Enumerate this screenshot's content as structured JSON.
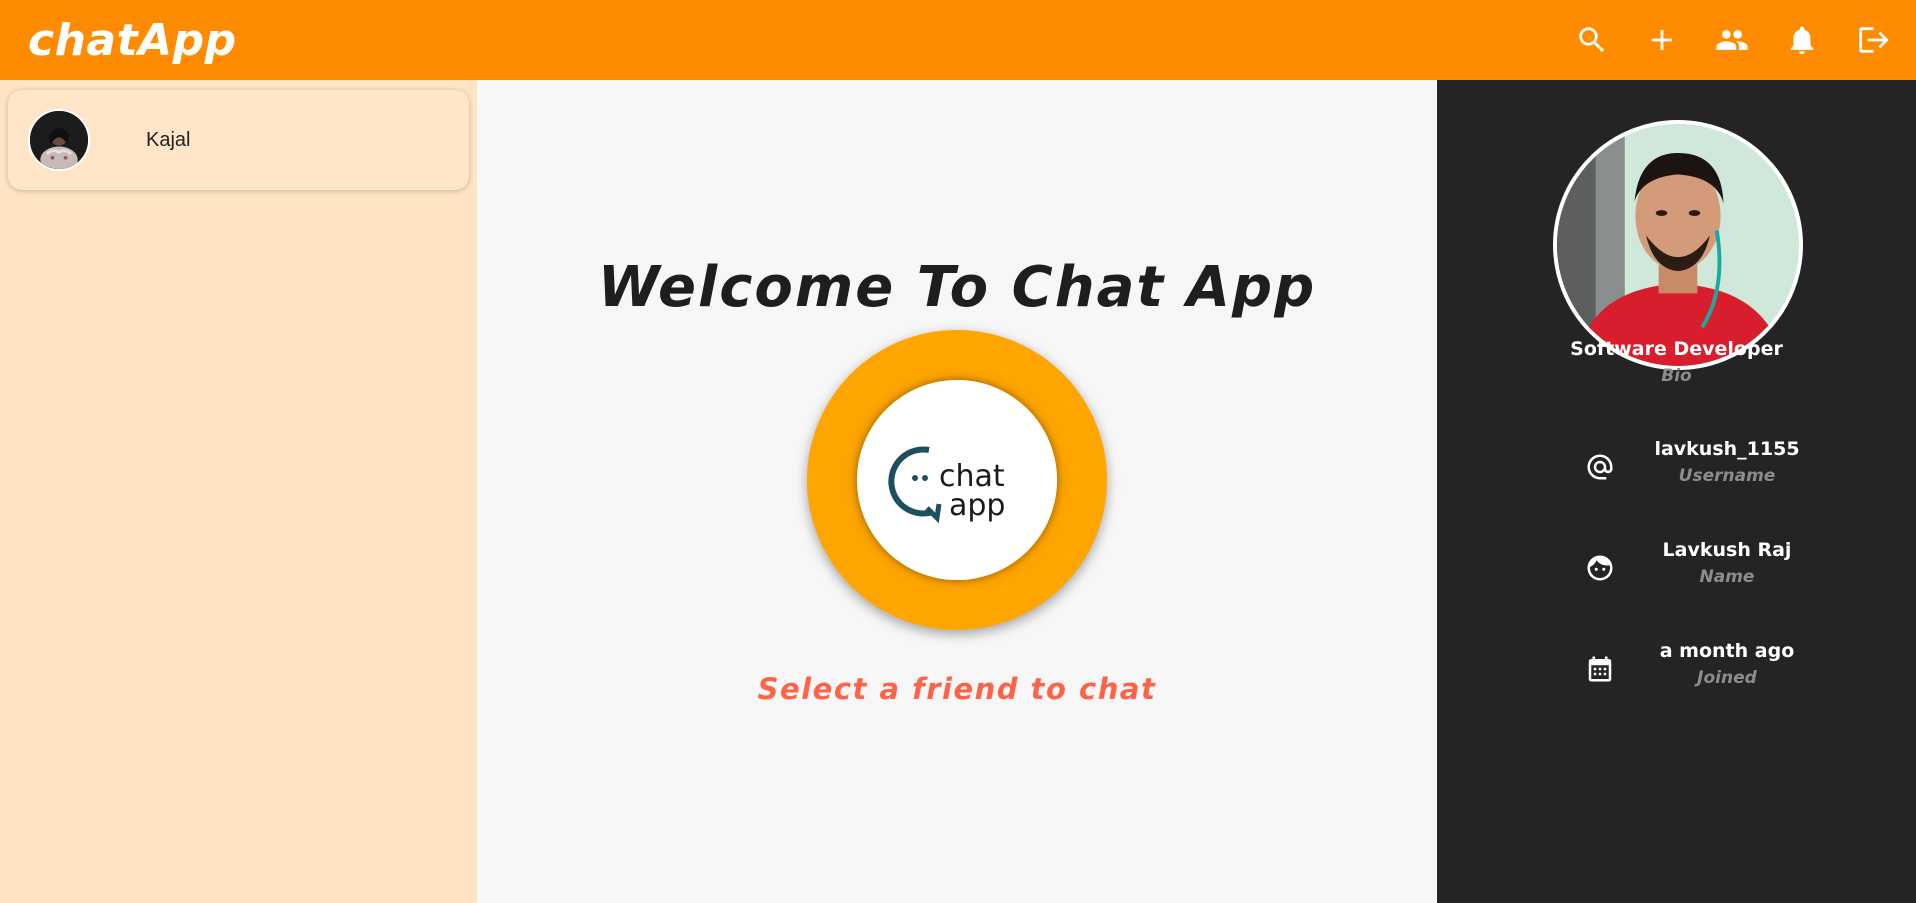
{
  "header": {
    "brand": "chatApp",
    "actions": [
      {
        "icon": "search-icon"
      },
      {
        "icon": "plus-icon"
      },
      {
        "icon": "people-icon"
      },
      {
        "icon": "bell-icon"
      },
      {
        "icon": "logout-icon"
      }
    ]
  },
  "sidebar": {
    "contacts": [
      {
        "name": "Kajal"
      }
    ]
  },
  "main": {
    "welcome": "Welcome To Chat App",
    "prompt": "Select a friend to chat",
    "logo_text_top": "chat",
    "logo_text_bottom": "app"
  },
  "profile": {
    "bio": {
      "value": "Software Developer",
      "label": "Bio"
    },
    "username": {
      "value": "lavkush_1155",
      "label": "Username",
      "icon": "at-icon"
    },
    "name": {
      "value": "Lavkush Raj",
      "label": "Name",
      "icon": "face-icon"
    },
    "joined": {
      "value": "a month ago",
      "label": "Joined",
      "icon": "calendar-icon"
    }
  },
  "colors": {
    "topbar": "#ff8c00",
    "sidebar": "#ffe4c4",
    "profile_panel": "#242424",
    "logo_ring": "#ffa500",
    "prompt_text": "#ff6347"
  }
}
